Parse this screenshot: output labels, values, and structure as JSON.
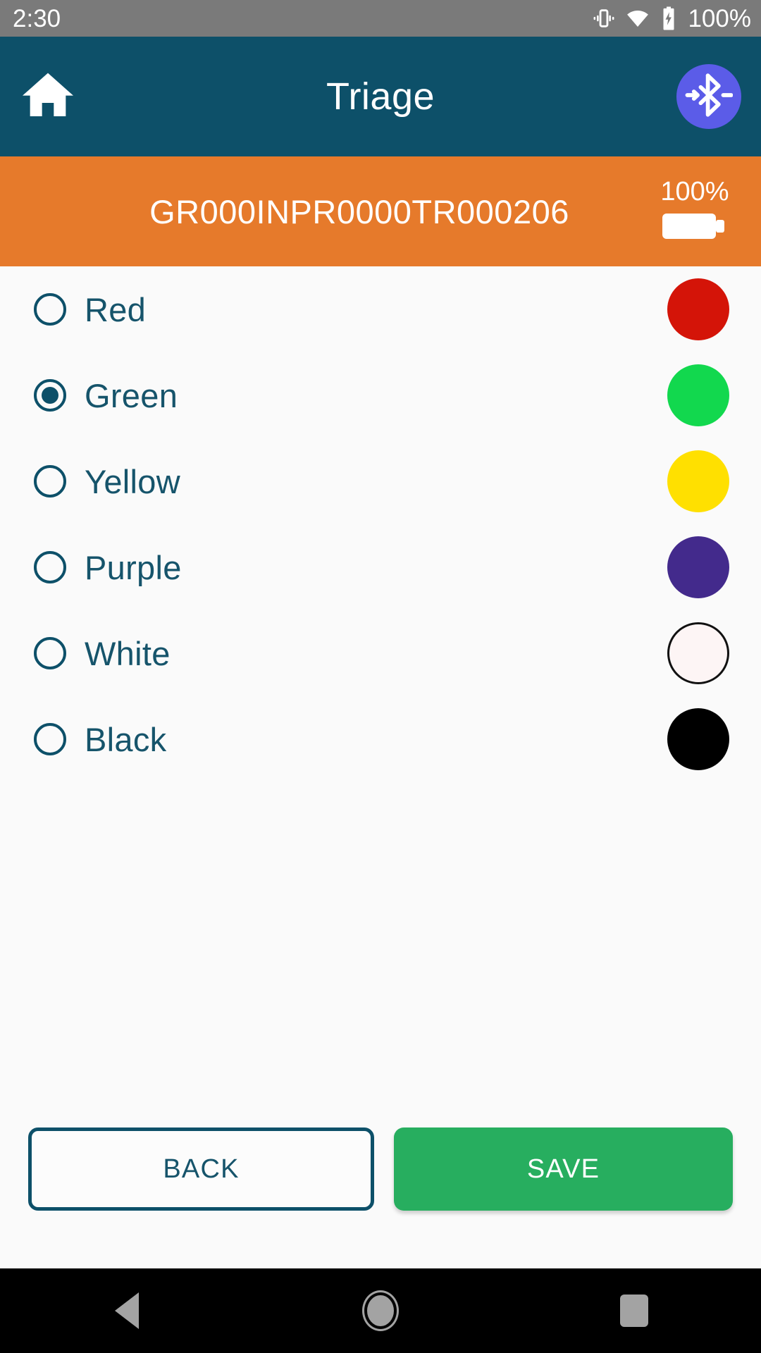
{
  "status_bar": {
    "clock": "2:30",
    "battery_percent": "100%",
    "icons": [
      "vibrate-icon",
      "wifi-icon",
      "battery-charging-icon"
    ],
    "background_color": "#7a7a7a"
  },
  "app_bar": {
    "title": "Triage",
    "home_icon": "home-icon",
    "bluetooth_icon": "bluetooth-connect-icon",
    "background_color": "#0d5069",
    "bluetooth_badge_color": "#5b5ce8"
  },
  "id_bar": {
    "identifier": "GR000INPR0000TR000206",
    "battery_percent": "100%",
    "battery_icon": "battery-full-icon",
    "background_color": "#e67a2b"
  },
  "options": {
    "selected": "Green",
    "items": [
      {
        "label": "Red",
        "checked": false,
        "swatch_color": "#d41408",
        "swatch_border": "none"
      },
      {
        "label": "Green",
        "checked": true,
        "swatch_color": "#12d84e",
        "swatch_border": "none"
      },
      {
        "label": "Yellow",
        "checked": false,
        "swatch_color": "#ffe000",
        "swatch_border": "none"
      },
      {
        "label": "Purple",
        "checked": false,
        "swatch_color": "#432a8c",
        "swatch_border": "none"
      },
      {
        "label": "White",
        "checked": false,
        "swatch_color": "#fdf5f5",
        "swatch_border": "3px solid #111111"
      },
      {
        "label": "Black",
        "checked": false,
        "swatch_color": "#000000",
        "swatch_border": "none"
      }
    ]
  },
  "footer": {
    "back_label": "BACK",
    "save_label": "SAVE",
    "save_color": "#27ae5f",
    "back_border_color": "#0d5069"
  },
  "nav_bar": {
    "back_icon": "nav-back-triangle-icon",
    "home_icon": "nav-home-circle-icon",
    "recents_icon": "nav-recents-square-icon",
    "background_color": "#000000"
  }
}
